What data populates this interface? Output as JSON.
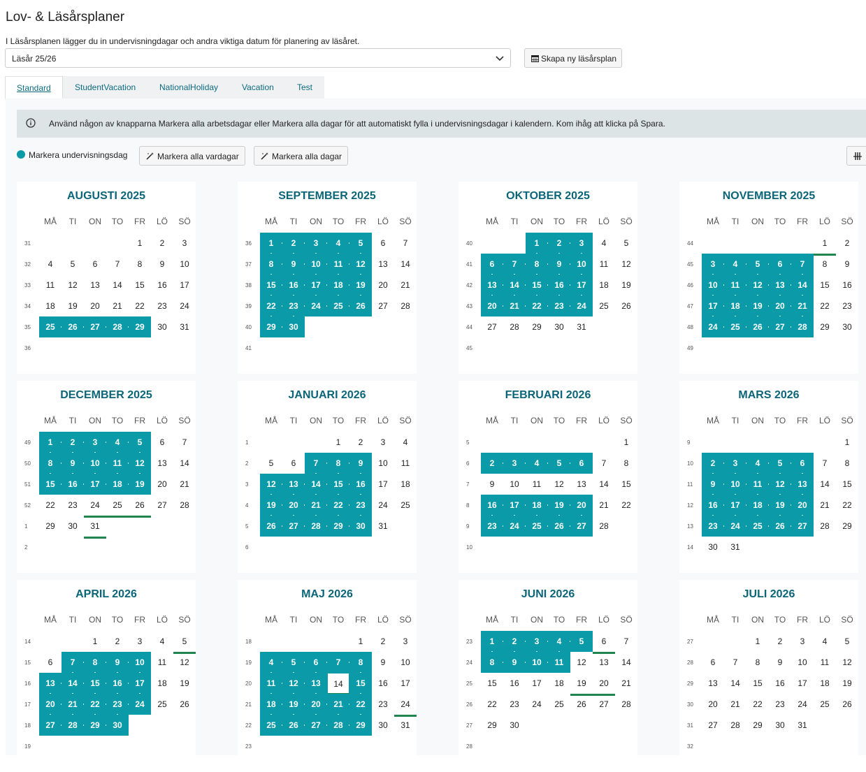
{
  "header": {
    "title": "Lov- & Läsårsplaner",
    "description": "I Läsårsplanen lägger du in undervisningdagar och andra viktiga datum för planering av läsåret.",
    "year_select_value": "Läsår 25/26",
    "new_plan_button": "Skapa ny läsårsplan"
  },
  "tabs": [
    {
      "label": "Standard",
      "active": true
    },
    {
      "label": "StudentVacation"
    },
    {
      "label": "NationalHoliday"
    },
    {
      "label": "Vacation"
    },
    {
      "label": "Test"
    }
  ],
  "info_text": "Använd någon av knapparna Markera alla arbetsdagar eller Markera alla dagar för att automatiskt fylla i undervisningsdagar i kalendern. Kom ihåg att klicka på Spara.",
  "legend_label": "Markera undervisningsdag",
  "toolbar": {
    "mark_weekdays": "Markera alla vardagar",
    "mark_all_days": "Markera alla dagar"
  },
  "weekday_headers": [
    "MÅ",
    "TI",
    "ON",
    "TO",
    "FR",
    "LÖ",
    "SÖ"
  ],
  "colors": {
    "teaching_day": "#0a9aa8",
    "holiday_marker": "#218550",
    "month_title": "#0b6579"
  },
  "months": [
    {
      "name": "AUGUSTI 2025",
      "start": 4,
      "days": 31,
      "weeks": [
        31,
        32,
        33,
        34,
        35,
        36
      ],
      "filled": [
        25,
        26,
        27,
        28,
        29
      ],
      "marked": []
    },
    {
      "name": "SEPTEMBER 2025",
      "start": 0,
      "days": 30,
      "weeks": [
        36,
        37,
        38,
        39,
        40,
        41
      ],
      "filled": [
        1,
        2,
        3,
        4,
        5,
        8,
        9,
        10,
        11,
        12,
        15,
        16,
        17,
        18,
        19,
        22,
        23,
        24,
        25,
        26,
        29,
        30
      ],
      "marked": []
    },
    {
      "name": "OKTOBER 2025",
      "start": 2,
      "days": 31,
      "weeks": [
        40,
        41,
        42,
        43,
        44,
        45
      ],
      "filled": [
        1,
        2,
        3,
        6,
        7,
        8,
        9,
        10,
        13,
        14,
        15,
        16,
        17,
        20,
        21,
        22,
        23,
        24
      ],
      "marked": []
    },
    {
      "name": "NOVEMBER 2025",
      "start": 5,
      "days": 30,
      "weeks": [
        44,
        45,
        46,
        47,
        48,
        49
      ],
      "filled": [
        3,
        4,
        5,
        6,
        7,
        10,
        11,
        12,
        13,
        14,
        17,
        18,
        19,
        20,
        21,
        24,
        25,
        26,
        27,
        28
      ],
      "marked": [
        1
      ]
    },
    {
      "name": "DECEMBER 2025",
      "start": 0,
      "days": 31,
      "weeks": [
        49,
        50,
        51,
        52,
        1,
        2
      ],
      "filled": [
        1,
        2,
        3,
        4,
        5,
        8,
        9,
        10,
        11,
        12,
        15,
        16,
        17,
        18,
        19
      ],
      "marked": [
        24,
        25,
        26,
        31
      ]
    },
    {
      "name": "JANUARI 2026",
      "start": 3,
      "days": 31,
      "weeks": [
        1,
        2,
        3,
        4,
        5,
        6
      ],
      "filled": [
        7,
        8,
        9,
        12,
        13,
        14,
        15,
        16,
        19,
        20,
        21,
        22,
        23,
        26,
        27,
        28,
        29,
        30
      ],
      "marked": [
        1,
        6
      ]
    },
    {
      "name": "FEBRUARI 2026",
      "start": 6,
      "days": 28,
      "weeks": [
        5,
        6,
        7,
        8,
        9,
        10
      ],
      "filled": [
        2,
        3,
        4,
        5,
        6,
        16,
        17,
        18,
        19,
        20,
        23,
        24,
        25,
        26,
        27
      ],
      "marked": []
    },
    {
      "name": "MARS 2026",
      "start": 6,
      "days": 31,
      "weeks": [
        9,
        10,
        11,
        12,
        13,
        14
      ],
      "filled": [
        2,
        3,
        4,
        5,
        6,
        9,
        10,
        11,
        12,
        13,
        16,
        17,
        18,
        19,
        20,
        23,
        24,
        25,
        26,
        27
      ],
      "marked": []
    },
    {
      "name": "APRIL 2026",
      "start": 2,
      "days": 30,
      "weeks": [
        14,
        15,
        16,
        17,
        18,
        19
      ],
      "filled": [
        7,
        8,
        9,
        10,
        13,
        14,
        15,
        16,
        17,
        20,
        21,
        22,
        23,
        24,
        27,
        28,
        29,
        30
      ],
      "marked": [
        3,
        5,
        6
      ]
    },
    {
      "name": "MAJ 2026",
      "start": 4,
      "days": 31,
      "weeks": [
        18,
        19,
        20,
        21,
        22,
        23
      ],
      "filled": [
        4,
        5,
        6,
        7,
        8,
        11,
        12,
        13,
        15,
        18,
        19,
        20,
        21,
        22,
        25,
        26,
        27,
        28,
        29
      ],
      "marked": [
        1,
        14,
        24
      ],
      "today": 14
    },
    {
      "name": "JUNI 2026",
      "start": 0,
      "days": 30,
      "weeks": [
        23,
        24,
        25,
        26,
        27,
        28
      ],
      "filled": [
        1,
        2,
        3,
        4,
        5,
        8,
        9,
        10,
        11
      ],
      "marked": [
        6,
        19,
        20
      ]
    },
    {
      "name": "JULI 2026",
      "start": 2,
      "days": 31,
      "weeks": [
        27,
        28,
        29,
        30,
        31,
        32
      ],
      "filled": [],
      "marked": []
    }
  ]
}
